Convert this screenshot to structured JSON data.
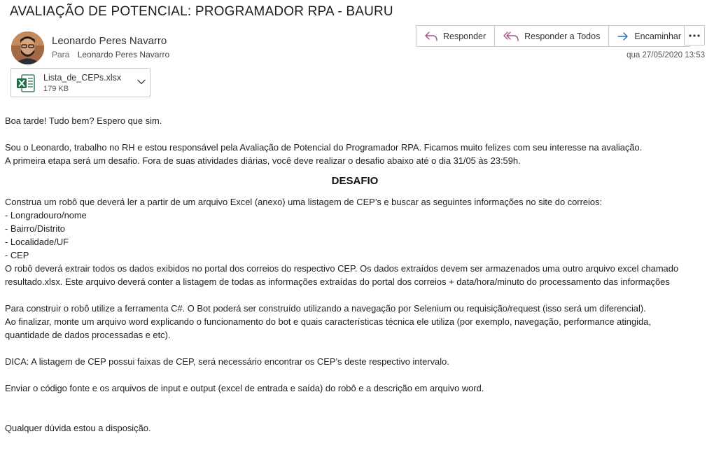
{
  "email": {
    "subject": "AVALIAÇÃO DE POTENCIAL: PROGRAMADOR RPA - BAURU",
    "sender": "Leonardo Peres Navarro",
    "to_label": "Para",
    "to_name": "Leonardo Peres Navarro",
    "date": "qua 27/05/2020 13:53"
  },
  "actions": {
    "reply": "Responder",
    "reply_all": "Responder a Todos",
    "forward": "Encaminhar"
  },
  "attachment": {
    "name": "Lista_de_CEPs.xlsx",
    "size": "179 KB",
    "icon": "excel-icon"
  },
  "body": {
    "greeting": "Boa tarde!  Tudo bem? Espero que sim.",
    "intro1": "Sou o Leonardo, trabalho no RH e estou responsável pela Avaliação de Potencial do Programador RPA. Ficamos muito felizes com seu interesse na avaliação.",
    "intro2": "A primeira etapa será um desafio. Fora de suas atividades diárias, você deve realizar o desafio abaixo até o dia 31/05 às 23:59h.",
    "heading": "DESAFIO",
    "task": "Construa um robô que deverá ler a partir de um arquivo Excel (anexo) uma listagem de CEP’s e buscar as seguintes informações no site do correios:",
    "items": [
      "- Longradouro/nome",
      "- Bairro/Distrito",
      "- Localidade/UF",
      "- CEP"
    ],
    "extract1": "O robô deverá extrair todos os dados exibidos no portal dos correios do respectivo CEP. Os dados extraídos devem ser armazenados uma outro arquivo excel chamado",
    "extract2": "resultado.xlsx. Este arquivo deverá conter a listagem de todas as informações extraídas do portal dos correios + data/hora/minuto do processamento das informações",
    "tool": "Para construir o robô utilize a ferramenta C#. O Bot poderá ser construído utilizando a navegação por Selenium ou requisição/request (isso será um diferencial).",
    "word1": "Ao finalizar, monte um arquivo word explicando o funcionamento do bot e quais características técnica ele utiliza (por exemplo, navegação, performance atingida,",
    "word2": "quantidade de dados processadas e etc).",
    "tip": "DICA: A listagem de CEP possui faixas de CEP, será necessário encontrar os CEP’s deste respectivo intervalo.",
    "send": "Enviar o código fonte e os arquivos de input e output (excel de entrada e saída) do robô e a descrição em arquivo word.",
    "closing": "Qualquer dúvida estou a disposição."
  },
  "colors": {
    "reply_icon": "#a74e8f",
    "forward_icon": "#2b6cb0",
    "excel_green": "#1d6f42"
  }
}
